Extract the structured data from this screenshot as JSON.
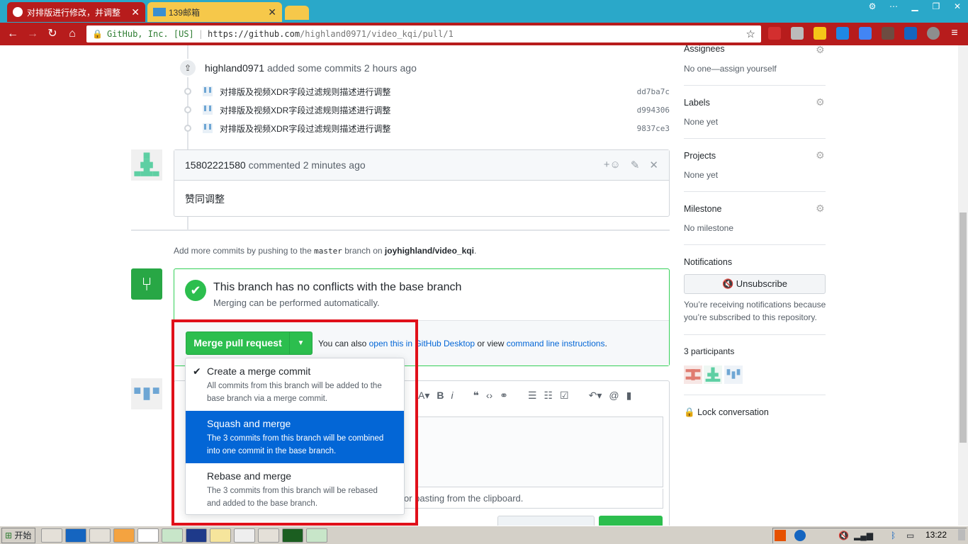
{
  "browser": {
    "tabs": [
      {
        "title": "对排版进行修改，并调整",
        "active": true
      },
      {
        "title": "139邮箱",
        "active": false
      }
    ],
    "url": {
      "org": "GitHub, Inc. [US]",
      "prefix": "https://github.com",
      "rest": "/highland0971/video_kqi/pull/1"
    }
  },
  "timeline": {
    "commits_event": {
      "actor": "highland0971",
      "action": "added some commits 2 hours ago"
    },
    "commits": [
      {
        "message": "对排版及视频XDR字段过滤规则描述进行调整",
        "sha": "dd7ba7c"
      },
      {
        "message": "对排版及视频XDR字段过滤规则描述进行调整",
        "sha": "d994306"
      },
      {
        "message": "对排版及视频XDR字段过滤规则描述进行调整",
        "sha": "9837ce3"
      }
    ],
    "comment": {
      "author": "15802221580",
      "meta": "commented 2 minutes ago",
      "body": "赞同调整"
    },
    "push_hint": {
      "prefix": "Add more commits by pushing to the",
      "branch": "master",
      "middle": "branch on",
      "repo": "joyhighland/video_kqi",
      "suffix": "."
    }
  },
  "merge": {
    "title": "This branch has no conflicts with the base branch",
    "subtitle": "Merging can be performed automatically.",
    "button_label": "Merge pull request",
    "note_prefix": "You can also",
    "note_link1": "open this in GitHub Desktop",
    "note_middle": "or view",
    "note_link2": "command line instructions",
    "note_suffix": ".",
    "options": [
      {
        "title": "Create a merge commit",
        "desc1": "All commits from this branch will be added to the",
        "desc2": "base branch via a merge commit.",
        "checked": true
      },
      {
        "title": "Squash and merge",
        "desc1": "The 3 commits from this branch will be combined",
        "desc2": "into one commit in the base branch.",
        "selected": true
      },
      {
        "title": "Rebase and merge",
        "desc1": "The 3 commits from this branch will be rebased",
        "desc2": "and added to the base branch."
      }
    ]
  },
  "editor": {
    "drop_hint": "or pasting from the clipboard."
  },
  "sidebar": {
    "assignees": {
      "label": "Assignees",
      "value": "No one—assign yourself"
    },
    "labels": {
      "label": "Labels",
      "value": "None yet"
    },
    "projects": {
      "label": "Projects",
      "value": "None yet"
    },
    "milestone": {
      "label": "Milestone",
      "value": "No milestone"
    },
    "notifications": {
      "label": "Notifications",
      "button": "Unsubscribe",
      "desc1": "You’re receiving notifications because",
      "desc2": "you’re subscribed to this repository."
    },
    "participants": {
      "label": "3 participants"
    },
    "lock": {
      "label": "Lock conversation"
    }
  },
  "taskbar": {
    "start": "开始",
    "clock": "13:22"
  },
  "colors": {
    "titlebar": "#2aa8c9",
    "navbar": "#b71c1c",
    "merge_green": "#2cbe4e",
    "selection_blue": "#0366d6",
    "highlight_red": "#e0101a"
  }
}
